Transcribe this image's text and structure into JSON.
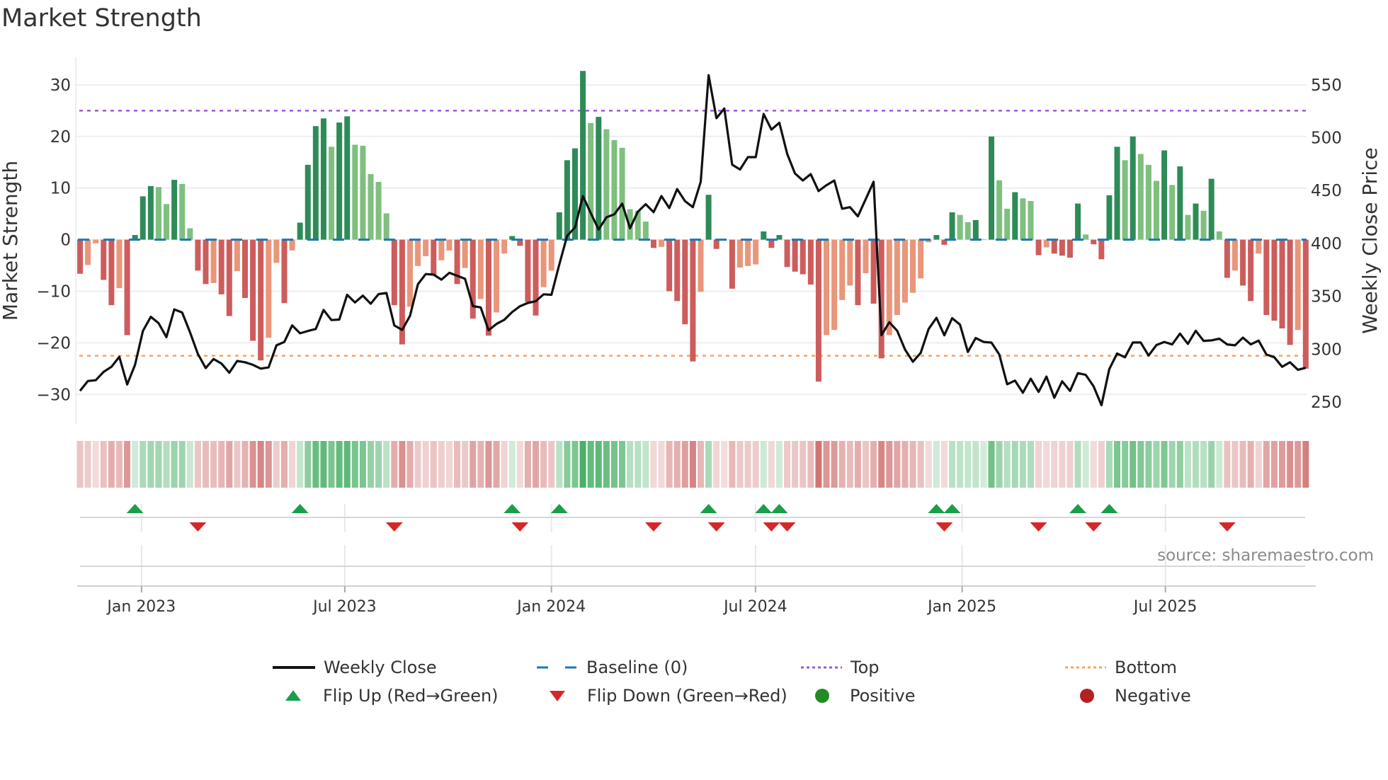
{
  "title": "Market Strength",
  "source": "source: sharemaestro.com",
  "legend": {
    "weekly_close": "Weekly Close",
    "baseline": "Baseline (0)",
    "top": "Top",
    "bottom": "Bottom",
    "flip_up": "Flip Up (Red→Green)",
    "flip_down": "Flip Down (Green→Red)",
    "positive": "Positive",
    "negative": "Negative"
  },
  "colors": {
    "strong_green": "#2e8b57",
    "weak_green": "#7fbf7f",
    "strong_red": "#cd5c5c",
    "weak_red": "#e9967a",
    "baseline": "#1f77b4",
    "top": "#9b59d6",
    "bottom": "#f4a460",
    "price": "#111111",
    "flip_up": "#1a9e4a",
    "flip_down": "#d62728",
    "positive": "#228b22",
    "negative": "#b22222",
    "strip_green": "#3aa95a",
    "strip_red": "#cc6666"
  },
  "chart_data": {
    "type": "bar",
    "title": "Market Strength",
    "ylabel": "Market Strength",
    "y2label": "Weekly Close Price",
    "ylim": [
      -35.5,
      35.5
    ],
    "y2lim": [
      226,
      574
    ],
    "yticks": [
      -30,
      -20,
      -10,
      0,
      10,
      20,
      30
    ],
    "ytick_labels": [
      "−30",
      "−20",
      "−10",
      "0",
      "10",
      "20",
      "30"
    ],
    "y2ticks": [
      250,
      300,
      350,
      400,
      450,
      500,
      550
    ],
    "y2tick_labels": [
      "250",
      "300",
      "350",
      "400",
      "450",
      "500",
      "550"
    ],
    "xticks": [
      {
        "label": "Jan 2023",
        "week_index": 7.83
      },
      {
        "label": "Jul 2023",
        "week_index": 33.7
      },
      {
        "label": "Jan 2024",
        "week_index": 60.0
      },
      {
        "label": "Jul 2024",
        "week_index": 85.97
      },
      {
        "label": "Jan 2025",
        "week_index": 112.27
      },
      {
        "label": "Jul 2025",
        "week_index": 138.14
      }
    ],
    "grid": true,
    "baseline": 0,
    "top_line": 25,
    "bottom_line": -22.5,
    "legend_position": "bottom",
    "strength": [
      -6.6,
      -4.9,
      -0.7,
      -7.8,
      -12.7,
      -9.4,
      -18.5,
      0.9,
      8.4,
      10.4,
      10.2,
      6.9,
      11.6,
      10.8,
      2.2,
      -6.0,
      -8.6,
      -8.4,
      -10.6,
      -14.8,
      -6.1,
      -11.3,
      -19.6,
      -23.4,
      -19.0,
      -4.5,
      -12.3,
      -2.1,
      3.3,
      14.5,
      22.0,
      23.5,
      18.0,
      22.7,
      23.9,
      18.4,
      18.2,
      12.7,
      11.2,
      5.1,
      -12.7,
      -20.3,
      -13.0,
      -5.1,
      -3.2,
      -6.8,
      -4.0,
      -2.1,
      -8.6,
      -5.5,
      -15.3,
      -11.5,
      -18.6,
      -14.1,
      -2.7,
      0.7,
      -1.2,
      -12.1,
      -14.7,
      -9.2,
      -6.0,
      5.3,
      15.4,
      17.7,
      32.7,
      22.6,
      23.8,
      21.4,
      19.3,
      17.8,
      5.9,
      5.6,
      3.5,
      -1.6,
      -1.4,
      -10.0,
      -11.9,
      -16.4,
      -23.6,
      -10.1,
      8.7,
      -1.8,
      -0.1,
      -9.5,
      -5.4,
      -5.1,
      -4.8,
      1.6,
      -1.6,
      0.9,
      -5.3,
      -6.2,
      -6.7,
      -8.7,
      -27.5,
      -18.5,
      -17.5,
      -11.7,
      -8.9,
      -12.7,
      -6.5,
      -12.4,
      -23.0,
      -18.5,
      -14.6,
      -12.2,
      -10.3,
      -7.5,
      -0.5,
      0.9,
      -1.0,
      5.3,
      4.8,
      3.4,
      3.8,
      0.1,
      20.0,
      11.5,
      6.0,
      9.2,
      8.0,
      7.5,
      -3.0,
      -1.5,
      -2.7,
      -3.1,
      -3.5,
      7.0,
      1.0,
      -0.9,
      -3.8,
      8.6,
      18.0,
      15.4,
      20.0,
      16.6,
      14.5,
      11.4,
      17.3,
      10.6,
      14.2,
      4.8,
      7.0,
      5.6,
      11.8,
      1.6,
      -7.4,
      -6.0,
      -8.9,
      -11.9,
      -2.7,
      -14.6,
      -15.7,
      -17.2,
      -20.4,
      -17.5,
      -25.0
    ],
    "weekly_close": [
      260.5,
      269.9,
      270.6,
      278.5,
      283.3,
      292.8,
      266.6,
      285.2,
      317.2,
      330.6,
      324.6,
      311.4,
      337.6,
      334.7,
      316.0,
      295.5,
      282.1,
      290.7,
      286.4,
      277.7,
      288.8,
      287.6,
      285.2,
      281.6,
      282.8,
      303.6,
      306.8,
      322.5,
      315.0,
      317.2,
      319.1,
      337.1,
      327.5,
      328.0,
      351.4,
      344.2,
      350.6,
      343.0,
      352.1,
      353.1,
      322.5,
      318.2,
      331.6,
      361.4,
      371.0,
      370.5,
      365.7,
      372.2,
      369.4,
      366.5,
      340.7,
      339.5,
      317.9,
      323.8,
      327.8,
      335.1,
      340.6,
      343.7,
      345.3,
      351.9,
      351.4,
      380.1,
      407.2,
      415.1,
      444.8,
      428.7,
      413.2,
      424.7,
      427.5,
      437.6,
      414.3,
      430.0,
      437.1,
      429.5,
      444.8,
      433.5,
      451.4,
      440.0,
      434.3,
      458.3,
      559.1,
      518.4,
      527.6,
      474.5,
      469.9,
      481.6,
      481.6,
      522.4,
      507.6,
      514.1,
      484.7,
      466.1,
      459.5,
      465.5,
      449.5,
      455.0,
      459.5,
      432.8,
      434.3,
      425.6,
      441.9,
      458.3,
      313.1,
      325.5,
      317.4,
      299.6,
      288.1,
      296.6,
      319.1,
      329.6,
      313.1,
      329.3,
      323.2,
      297.4,
      310.5,
      306.8,
      306.2,
      294.9,
      266.8,
      270.3,
      258.8,
      272.1,
      259.6,
      274.0,
      254.1,
      269.6,
      260.5,
      277.3,
      275.7,
      264.8,
      247.0,
      281.1,
      295.9,
      292.3,
      306.3,
      306.3,
      294.0,
      303.9,
      306.8,
      304.5,
      314.7,
      305.0,
      317.4,
      307.8,
      308.3,
      309.9,
      304.5,
      303.6,
      310.9,
      304.5,
      308.1,
      294.9,
      292.4,
      283.3,
      287.6,
      280.5,
      282.3
    ],
    "flip_up_weeks": [
      7,
      28,
      55,
      61,
      80,
      87,
      89,
      109,
      111,
      127,
      131
    ],
    "flip_down_weeks": [
      15,
      40,
      56,
      73,
      81,
      88,
      90,
      110,
      122,
      129,
      146
    ]
  }
}
